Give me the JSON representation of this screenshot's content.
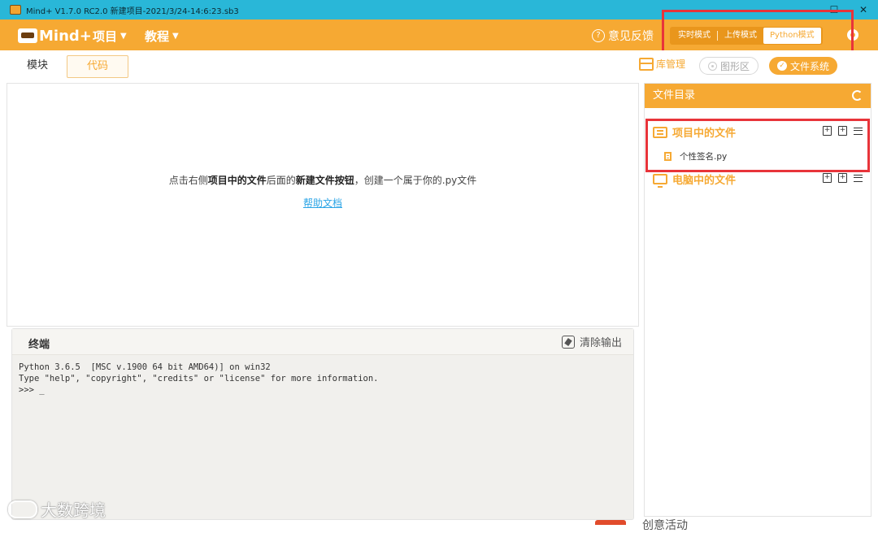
{
  "window": {
    "title": "Mind+ V1.7.0 RC2.0   新建项目-2021/3/24-14:6:23.sb3",
    "controls": [
      "–",
      "☐",
      "✕"
    ]
  },
  "topbar": {
    "logo_text": "Mind+",
    "menu_project": "项目",
    "menu_tutorial": "教程",
    "feedback_label": "意见反馈",
    "modes": [
      "实时模式",
      "上传模式",
      "Python模式"
    ],
    "active_mode": "Python模式"
  },
  "tabs": {
    "blocks": "模块",
    "code": "代码"
  },
  "toolbar": {
    "library": "库管理",
    "graphics": "图形区",
    "file_system": "文件系统"
  },
  "editor": {
    "hint_prefix": "点击右侧",
    "hint_bold1": "项目中的文件",
    "hint_mid": "后面的",
    "hint_bold2": "新建文件按钮",
    "hint_suffix": "，创建一个属于你的.py文件",
    "help_link": "帮助文档"
  },
  "terminal": {
    "title": "终端",
    "clear_label": "清除输出",
    "lines": "Python 3.6.5  [MSC v.1900 64 bit AMD64)] on win32\nType \"help\", \"copyright\", \"credits\" or \"license\" for more information.\n>>> _"
  },
  "file_panel": {
    "header": "文件目录",
    "project_files": "项目中的文件",
    "computer_files": "电脑中的文件",
    "files": [
      "个性签名.py"
    ]
  },
  "overlay": {
    "watermark": "大数跨境",
    "peek_text": "创意活动"
  },
  "colors": {
    "accent": "#f6a933",
    "titlebar": "#29b7d8",
    "highlight_box": "#e8343a",
    "link": "#2aa4e6"
  }
}
